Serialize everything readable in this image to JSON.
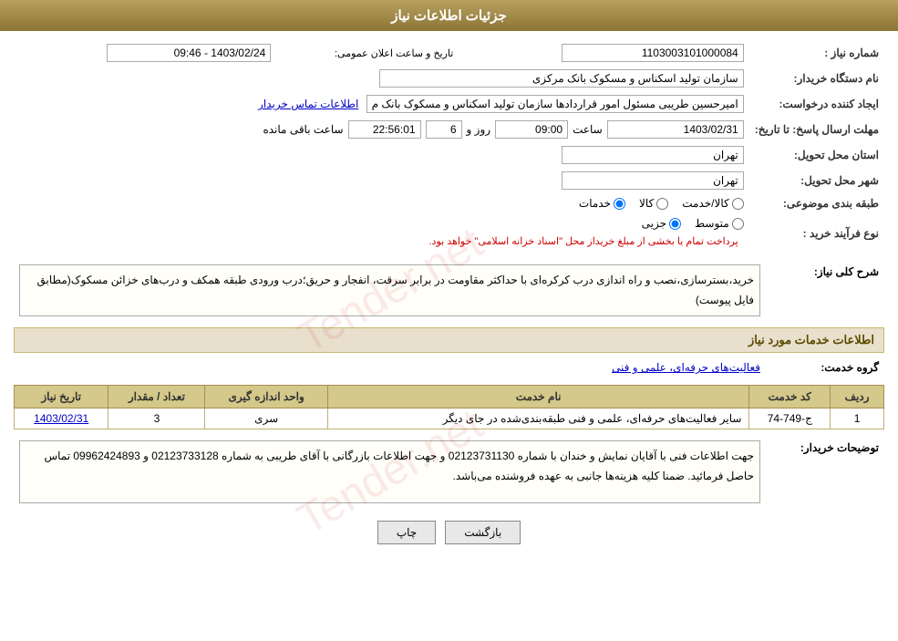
{
  "header": {
    "title": "جزئیات اطلاعات نیاز"
  },
  "fields": {
    "shomara_niaz_label": "شماره نیاز :",
    "shomara_niaz_value": "1103003101000084",
    "nam_dastgah_label": "نام دستگاه خریدار:",
    "nam_dastgah_value": "سازمان تولید اسکناس و مسکوک بانک مرکزی",
    "ijad_konande_label": "ایجاد کننده درخواست:",
    "ijad_konande_value": "امیرحسین طریبی مسئول امور قراردادها سازمان تولید اسکناس و مسکوک بانک م",
    "ijad_konande_link": "اطلاعات تماس خریدار",
    "mohlat_label": "مهلت ارسال پاسخ: تا تاریخ:",
    "date_value": "1403/02/31",
    "saat_label": "ساعت",
    "saat_value": "09:00",
    "rooz_label": "روز و",
    "rooz_value": "6",
    "baqi_mande_label": "ساعت باقی مانده",
    "baqi_mande_value": "22:56:01",
    "ostan_label": "استان محل تحویل:",
    "ostan_value": "تهران",
    "shahr_label": "شهر محل تحویل:",
    "shahr_value": "تهران",
    "tasnif_label": "طبقه بندی موضوعی:",
    "radio_khadamat": "خدمات",
    "radio_kala": "کالا",
    "radio_kala_khadamat": "کالا/خدمت",
    "faraiand_label": "نوع فرآیند خرید :",
    "radio_jozvi": "جزیی",
    "radio_motovaset": "متوسط",
    "faraiand_note": "پرداخت تمام یا بخشی از مبلغ خریداز محل \"اسناد خزانه اسلامی\" خواهد بود.",
    "sharh_label": "شرح کلی نیاز:",
    "sharh_value": "خرید،بسترسازی،نصب و راه اندازی درب کرکره‌ای با حداکثر مقاومت در برابر سرقت، انفجار و حریق؛درب ورودی طبقه همکف و درب‌های خزائن مسکوک(مطابق فایل پیوست)",
    "khadamat_section": "اطلاعات خدمات مورد نیاز",
    "grooh_label": "گروه خدمت:",
    "grooh_value": "فعالیت‌های حرفه‌ای، علمی و فنی",
    "table": {
      "headers": [
        "ردیف",
        "کد خدمت",
        "نام خدمت",
        "واحد اندازه گیری",
        "تعداد / مقدار",
        "تاریخ نیاز"
      ],
      "rows": [
        {
          "radif": "1",
          "kod": "ج-749-74",
          "name": "سایر فعالیت‌های حرفه‌ای، علمی و فنی طبقه‌بندی‌شده در جای دیگر",
          "vahed": "سری",
          "tedad": "3",
          "tarikh": "1403/02/31"
        }
      ]
    },
    "tavzih_label": "توضیحات خریدار:",
    "tavzih_value": "جهت اطلاعات فنی با آقایان نمایش و خندان با شماره 02123731130 و جهت اطلاعات بازرگانی با آقای طریبی به شماره 02123733128 و 09962424893 تماس حاصل فرمائید. ضمنا کلیه هزینه‌ها جانبی به عهده فروشنده می‌باشد."
  },
  "buttons": {
    "print_label": "چاپ",
    "return_label": "بازگشت"
  }
}
